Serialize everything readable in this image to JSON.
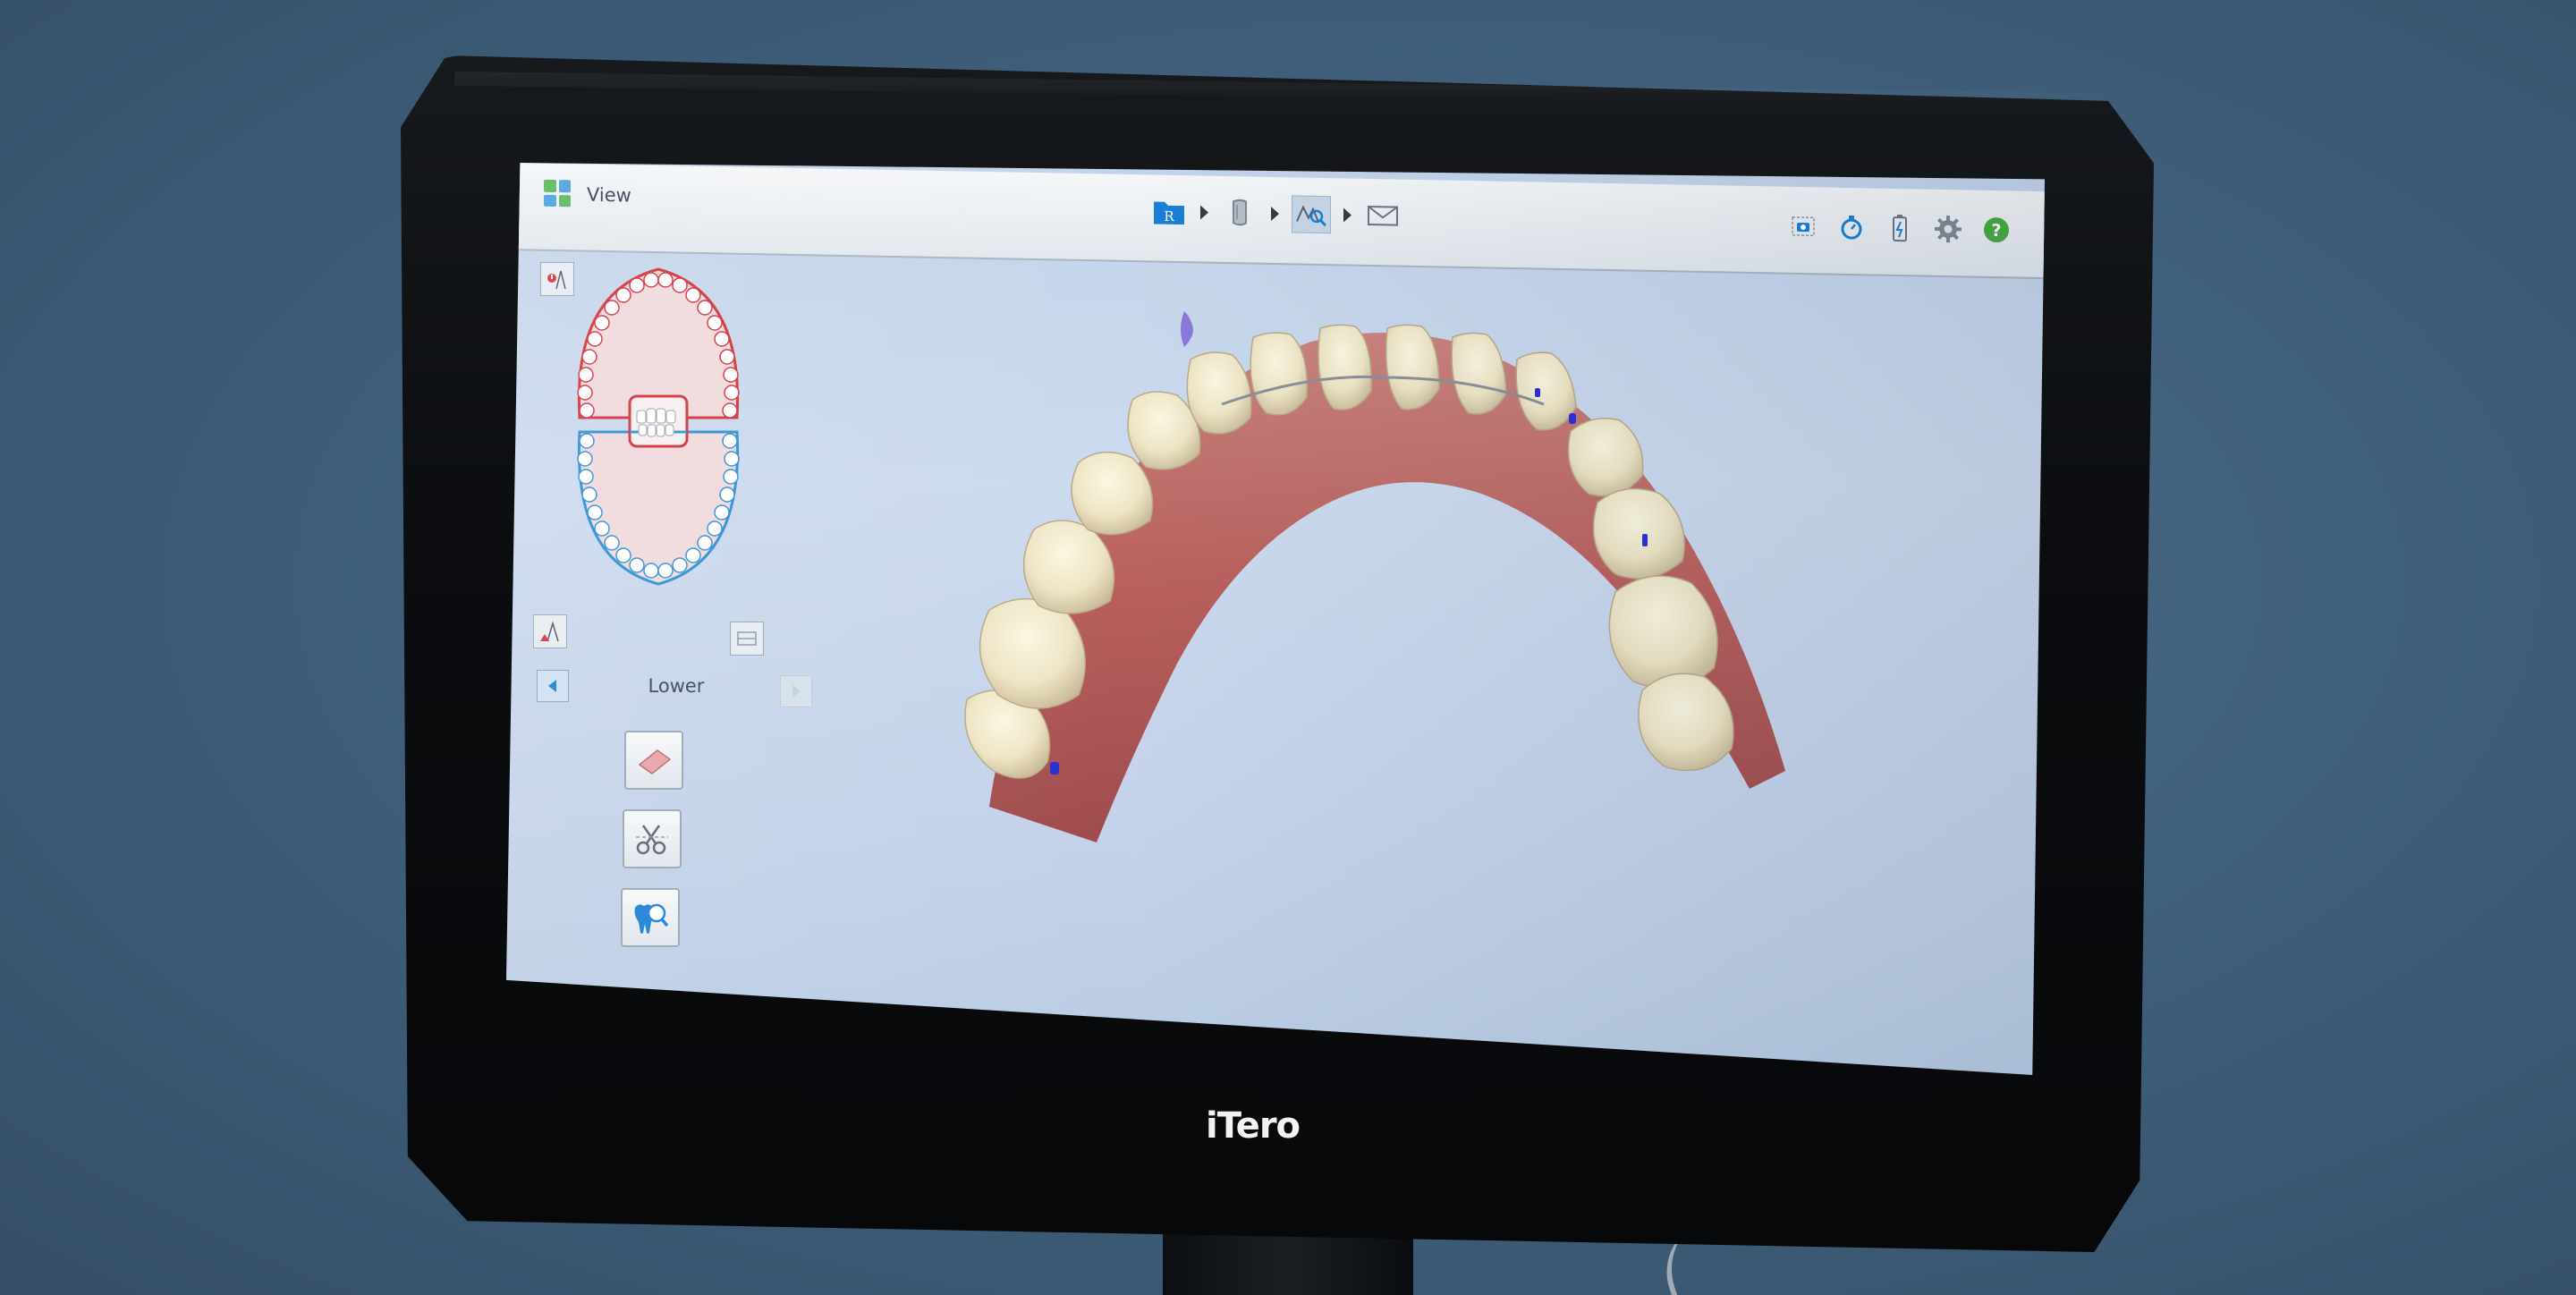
{
  "device": {
    "brand": "iTero"
  },
  "titlebar": {
    "app_label": "View",
    "workflow_steps": [
      {
        "name": "patient-folder",
        "badge": "R",
        "active": false
      },
      {
        "name": "scan",
        "active": false
      },
      {
        "name": "view",
        "active": true
      },
      {
        "name": "send",
        "active": false
      }
    ],
    "tools": [
      "camera-icon",
      "timer-icon",
      "battery-icon",
      "gear-icon",
      "help-icon"
    ],
    "help_glyph": "?"
  },
  "left_panel": {
    "jaw_label": "Lower",
    "selected_jaw": "lower",
    "tools": [
      "eraser-tool",
      "trim-tool",
      "tooth-magnify-tool"
    ]
  },
  "colors": {
    "upper_arch": "#d2343b",
    "lower_arch": "#2e8fd6",
    "accent_blue": "#1a7fd4",
    "help_green": "#47a840",
    "screen_bg": "#c8d7ec"
  }
}
